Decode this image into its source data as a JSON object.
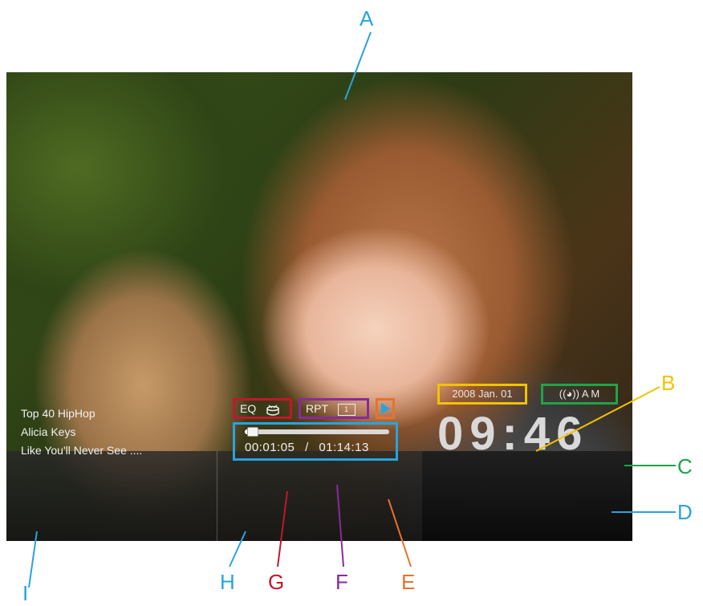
{
  "music": {
    "playlist": "Top 40 HipHop",
    "artist": "Alicia Keys",
    "track": "Like You'll Never See ...."
  },
  "controls": {
    "eq_label": "EQ",
    "repeat_label": "RPT",
    "repeat_mode": "1",
    "progress_fraction": 0.015,
    "elapsed": "00:01:05",
    "separator": "/",
    "total": "01:14:13"
  },
  "clock": {
    "date": "2008  Jan. 01",
    "alarm": "((◕))  A M",
    "time": "09:46"
  },
  "callouts": {
    "A": "A",
    "B": "B",
    "C": "C",
    "D": "D",
    "E": "E",
    "F": "F",
    "G": "G",
    "H": "H",
    "I": "I"
  },
  "colors": {
    "A": "#27a4de",
    "B": "#f2c300",
    "C": "#1fa34a",
    "D": "#27a4de",
    "E": "#e8722a",
    "F": "#8a2a9b",
    "G": "#c0182b",
    "H": "#27a4de",
    "I": "#27a4de"
  }
}
